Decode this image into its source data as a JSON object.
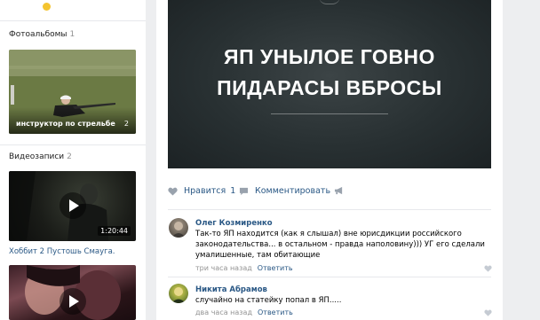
{
  "sidebar": {
    "photo_albums": {
      "title": "Фотоальбомы",
      "count": "1",
      "album_caption": "инструктор по стрельбе",
      "album_count": "2"
    },
    "videos": {
      "title": "Видеозаписи",
      "count": "2",
      "video1_duration": "1:20:44",
      "video1_title": "Хоббит 2 Пустошь Смауга."
    }
  },
  "post": {
    "image_text_line1": "ЯП УНЫЛОЕ ГОВНО",
    "image_text_line2": "ПИДАРАСЫ ВБРОСЫ",
    "like_label": "Нравится",
    "like_count": "1",
    "comment_label": "Комментировать"
  },
  "comments": [
    {
      "author": "Олег Козмиренко",
      "text_lines": [
        "Так-то ЯП находится (как я слышал) вне юрисдикции российского",
        "законодательства... в остальном - правда наполовину))) УГ его сделали",
        "умалишенные, там обитающие"
      ],
      "time": "три часа назад",
      "reply_label": "Ответить"
    },
    {
      "author": "Никита Абрамов",
      "text_lines": [
        "случайно на статейку попал в ЯП....."
      ],
      "time": "два часа назад",
      "reply_label": "Ответить"
    }
  ],
  "colors": {
    "link": "#2a5885",
    "meta": "#939393",
    "background": "#edeef0"
  }
}
